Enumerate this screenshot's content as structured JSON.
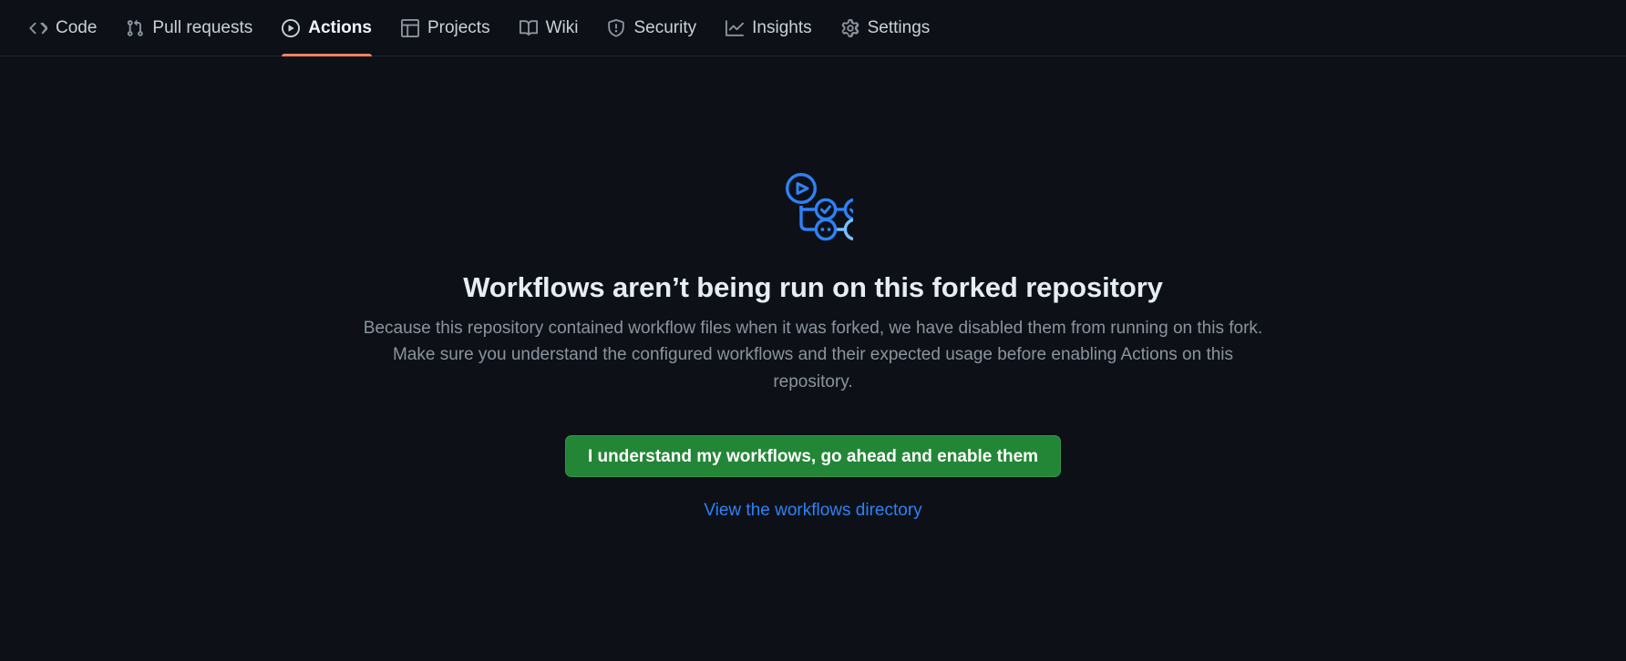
{
  "theme": {
    "background": "#0d1117",
    "nav_border": "#21262d",
    "nav_text": "#c9d1d9",
    "nav_text_selected": "#f0f6fc",
    "selected_underline": "#f78166",
    "heading_text": "#e6edf3",
    "muted_text": "#8b949e",
    "button_green": "#238636",
    "link_blue": "#2f81f7",
    "illustration_blue": "#2f81f7",
    "illustration_blue_faded": "#79c0ff"
  },
  "repo_nav": {
    "items": [
      {
        "label": "Code",
        "icon": "code-icon",
        "selected": false
      },
      {
        "label": "Pull requests",
        "icon": "git-pull-request-icon",
        "selected": false
      },
      {
        "label": "Actions",
        "icon": "play-icon",
        "selected": true
      },
      {
        "label": "Projects",
        "icon": "table-icon",
        "selected": false
      },
      {
        "label": "Wiki",
        "icon": "book-icon",
        "selected": false
      },
      {
        "label": "Security",
        "icon": "shield-icon",
        "selected": false
      },
      {
        "label": "Insights",
        "icon": "graph-icon",
        "selected": false
      },
      {
        "label": "Settings",
        "icon": "gear-icon",
        "selected": false
      }
    ]
  },
  "blankslate": {
    "illustration": "workflow-graph-icon",
    "heading": "Workflows aren’t being run on this forked repository",
    "body": "Because this repository contained workflow files when it was forked, we have disabled them from running on this fork. Make sure you understand the configured workflows and their expected usage before enabling Actions on this repository.",
    "primary_button": "I understand my workflows, go ahead and enable them",
    "secondary_link": "View the workflows directory"
  }
}
